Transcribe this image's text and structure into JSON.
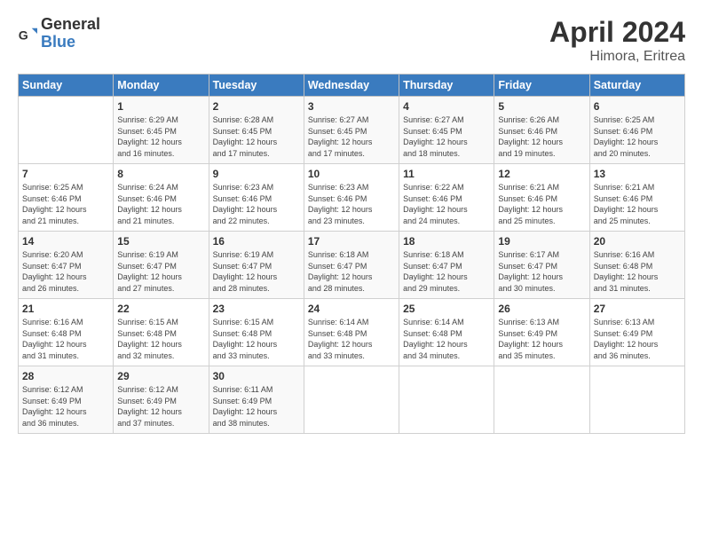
{
  "logo": {
    "general": "General",
    "blue": "Blue"
  },
  "title": "April 2024",
  "subtitle": "Himora, Eritrea",
  "weekdays": [
    "Sunday",
    "Monday",
    "Tuesday",
    "Wednesday",
    "Thursday",
    "Friday",
    "Saturday"
  ],
  "weeks": [
    [
      {
        "day": "",
        "info": ""
      },
      {
        "day": "1",
        "info": "Sunrise: 6:29 AM\nSunset: 6:45 PM\nDaylight: 12 hours\nand 16 minutes."
      },
      {
        "day": "2",
        "info": "Sunrise: 6:28 AM\nSunset: 6:45 PM\nDaylight: 12 hours\nand 17 minutes."
      },
      {
        "day": "3",
        "info": "Sunrise: 6:27 AM\nSunset: 6:45 PM\nDaylight: 12 hours\nand 17 minutes."
      },
      {
        "day": "4",
        "info": "Sunrise: 6:27 AM\nSunset: 6:45 PM\nDaylight: 12 hours\nand 18 minutes."
      },
      {
        "day": "5",
        "info": "Sunrise: 6:26 AM\nSunset: 6:46 PM\nDaylight: 12 hours\nand 19 minutes."
      },
      {
        "day": "6",
        "info": "Sunrise: 6:25 AM\nSunset: 6:46 PM\nDaylight: 12 hours\nand 20 minutes."
      }
    ],
    [
      {
        "day": "7",
        "info": "Sunrise: 6:25 AM\nSunset: 6:46 PM\nDaylight: 12 hours\nand 21 minutes."
      },
      {
        "day": "8",
        "info": "Sunrise: 6:24 AM\nSunset: 6:46 PM\nDaylight: 12 hours\nand 21 minutes."
      },
      {
        "day": "9",
        "info": "Sunrise: 6:23 AM\nSunset: 6:46 PM\nDaylight: 12 hours\nand 22 minutes."
      },
      {
        "day": "10",
        "info": "Sunrise: 6:23 AM\nSunset: 6:46 PM\nDaylight: 12 hours\nand 23 minutes."
      },
      {
        "day": "11",
        "info": "Sunrise: 6:22 AM\nSunset: 6:46 PM\nDaylight: 12 hours\nand 24 minutes."
      },
      {
        "day": "12",
        "info": "Sunrise: 6:21 AM\nSunset: 6:46 PM\nDaylight: 12 hours\nand 25 minutes."
      },
      {
        "day": "13",
        "info": "Sunrise: 6:21 AM\nSunset: 6:46 PM\nDaylight: 12 hours\nand 25 minutes."
      }
    ],
    [
      {
        "day": "14",
        "info": "Sunrise: 6:20 AM\nSunset: 6:47 PM\nDaylight: 12 hours\nand 26 minutes."
      },
      {
        "day": "15",
        "info": "Sunrise: 6:19 AM\nSunset: 6:47 PM\nDaylight: 12 hours\nand 27 minutes."
      },
      {
        "day": "16",
        "info": "Sunrise: 6:19 AM\nSunset: 6:47 PM\nDaylight: 12 hours\nand 28 minutes."
      },
      {
        "day": "17",
        "info": "Sunrise: 6:18 AM\nSunset: 6:47 PM\nDaylight: 12 hours\nand 28 minutes."
      },
      {
        "day": "18",
        "info": "Sunrise: 6:18 AM\nSunset: 6:47 PM\nDaylight: 12 hours\nand 29 minutes."
      },
      {
        "day": "19",
        "info": "Sunrise: 6:17 AM\nSunset: 6:47 PM\nDaylight: 12 hours\nand 30 minutes."
      },
      {
        "day": "20",
        "info": "Sunrise: 6:16 AM\nSunset: 6:48 PM\nDaylight: 12 hours\nand 31 minutes."
      }
    ],
    [
      {
        "day": "21",
        "info": "Sunrise: 6:16 AM\nSunset: 6:48 PM\nDaylight: 12 hours\nand 31 minutes."
      },
      {
        "day": "22",
        "info": "Sunrise: 6:15 AM\nSunset: 6:48 PM\nDaylight: 12 hours\nand 32 minutes."
      },
      {
        "day": "23",
        "info": "Sunrise: 6:15 AM\nSunset: 6:48 PM\nDaylight: 12 hours\nand 33 minutes."
      },
      {
        "day": "24",
        "info": "Sunrise: 6:14 AM\nSunset: 6:48 PM\nDaylight: 12 hours\nand 33 minutes."
      },
      {
        "day": "25",
        "info": "Sunrise: 6:14 AM\nSunset: 6:48 PM\nDaylight: 12 hours\nand 34 minutes."
      },
      {
        "day": "26",
        "info": "Sunrise: 6:13 AM\nSunset: 6:49 PM\nDaylight: 12 hours\nand 35 minutes."
      },
      {
        "day": "27",
        "info": "Sunrise: 6:13 AM\nSunset: 6:49 PM\nDaylight: 12 hours\nand 36 minutes."
      }
    ],
    [
      {
        "day": "28",
        "info": "Sunrise: 6:12 AM\nSunset: 6:49 PM\nDaylight: 12 hours\nand 36 minutes."
      },
      {
        "day": "29",
        "info": "Sunrise: 6:12 AM\nSunset: 6:49 PM\nDaylight: 12 hours\nand 37 minutes."
      },
      {
        "day": "30",
        "info": "Sunrise: 6:11 AM\nSunset: 6:49 PM\nDaylight: 12 hours\nand 38 minutes."
      },
      {
        "day": "",
        "info": ""
      },
      {
        "day": "",
        "info": ""
      },
      {
        "day": "",
        "info": ""
      },
      {
        "day": "",
        "info": ""
      }
    ]
  ]
}
